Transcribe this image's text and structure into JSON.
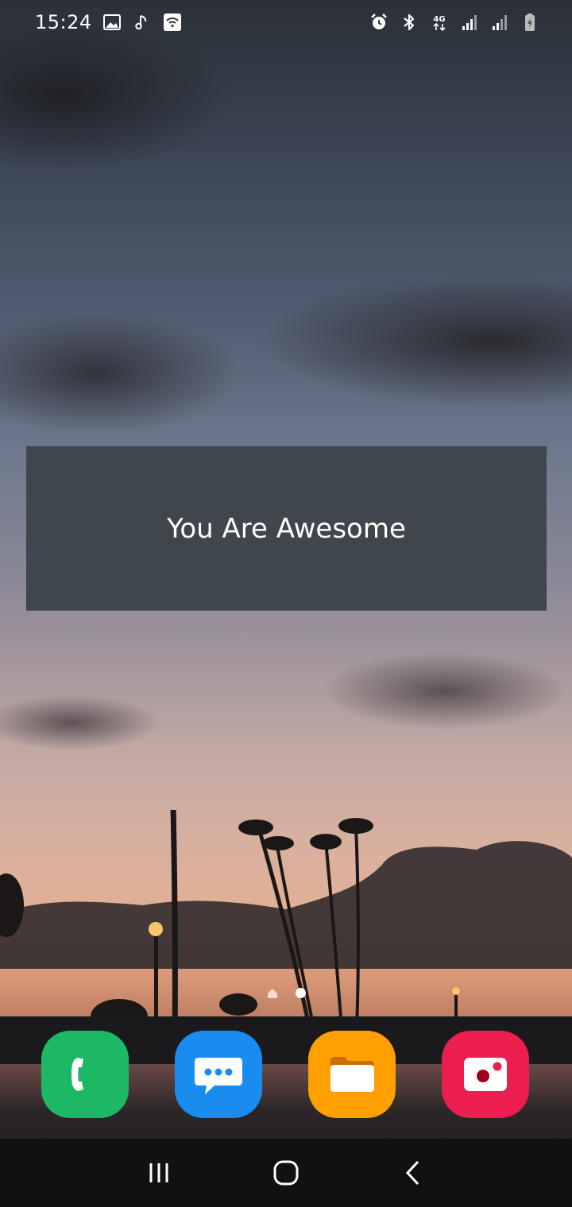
{
  "status_bar": {
    "time": "15:24",
    "left_icons": [
      "gallery-icon",
      "music-note-icon",
      "wifi-icon"
    ],
    "right_icons": [
      "alarm-icon",
      "bluetooth-icon",
      "network-4g-icon",
      "signal-icon",
      "signal-icon",
      "battery-charging-icon"
    ],
    "network_label": "4G"
  },
  "toast": {
    "message": "You Are Awesome"
  },
  "home": {
    "pages": 2,
    "current_page": 2
  },
  "dock": {
    "apps": [
      {
        "name": "phone",
        "icon": "phone-icon",
        "color": "#1db865"
      },
      {
        "name": "messages",
        "icon": "message-icon",
        "color": "#1a8cf0"
      },
      {
        "name": "files",
        "icon": "folder-icon",
        "color": "#ff9f00"
      },
      {
        "name": "camera",
        "icon": "camera-icon",
        "color": "#ec1e4f"
      }
    ]
  },
  "nav_bar": {
    "buttons": [
      "recents-icon",
      "home-icon",
      "back-icon"
    ]
  }
}
